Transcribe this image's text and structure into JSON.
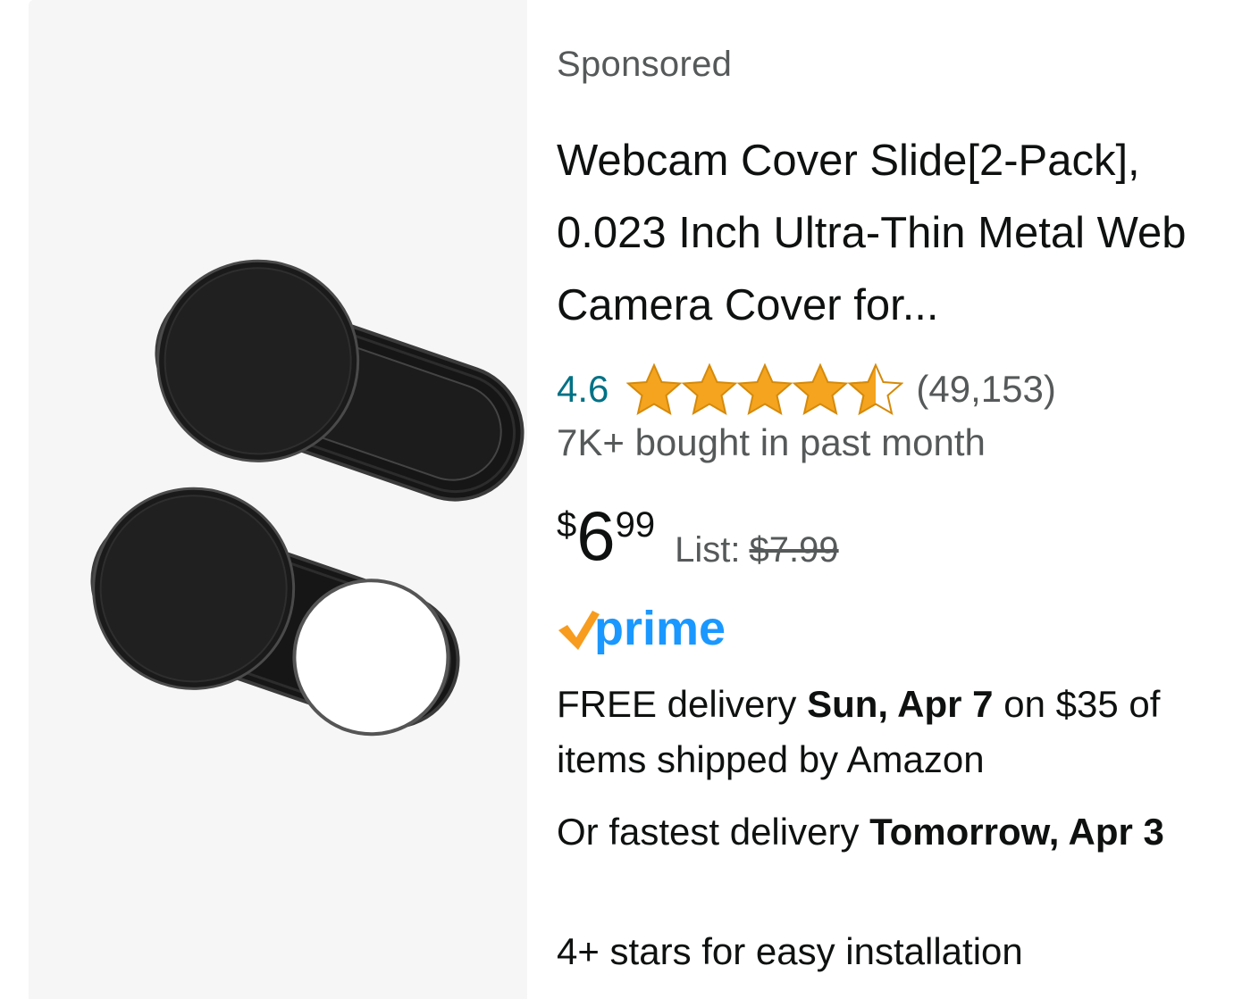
{
  "product": {
    "sponsored_label": "Sponsored",
    "title": "Webcam Cover Slide[2-Pack], 0.023 Inch Ultra-Thin Metal Web Camera Cover for...",
    "rating": "4.6",
    "rating_stars": 4.6,
    "review_count": "(49,153)",
    "bought_text": "7K+ bought in past month",
    "price": {
      "symbol": "$",
      "whole": "6",
      "fraction": "99",
      "list_label": "List:",
      "list_price": "$7.99"
    },
    "prime_label": "prime",
    "delivery": {
      "prefix": "FREE delivery ",
      "date": "Sun, Apr 7",
      "suffix": " on $35 of items shipped by Amazon"
    },
    "fastest": {
      "prefix": "Or fastest delivery ",
      "date": "Tomorrow, Apr 3"
    },
    "installation_text": "4+ stars for easy installation"
  },
  "colors": {
    "rating_link": "#007185",
    "star": "#f4a41e",
    "secondary_text": "#565959",
    "prime_blue": "#1a98ff",
    "prime_check": "#f79c1e",
    "image_bg": "#f6f6f6"
  },
  "icons": {
    "product_image": "webcam-cover-image",
    "star": "star-icon",
    "half_star": "half-star-icon",
    "prime_check": "prime-check-icon"
  }
}
